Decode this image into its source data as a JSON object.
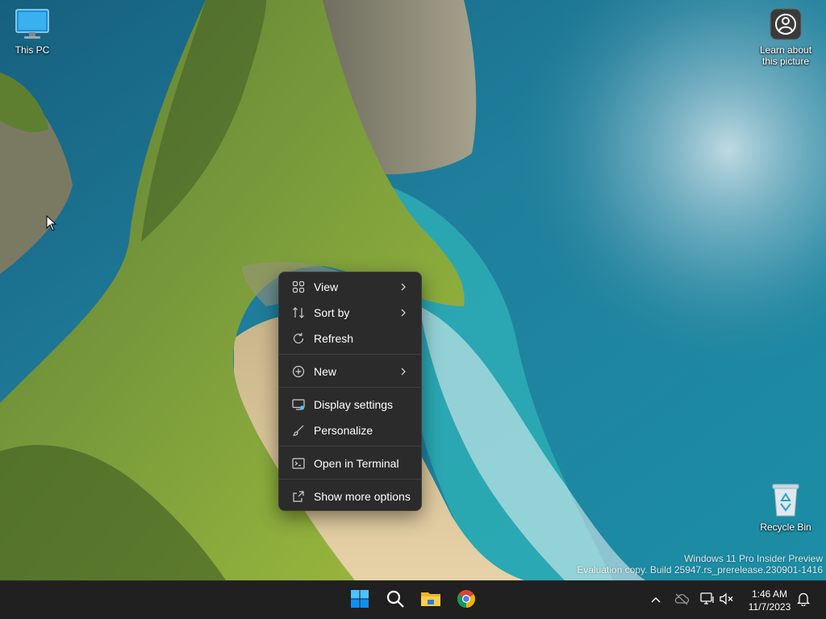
{
  "desktop": {
    "icons": [
      {
        "label": "This PC"
      },
      {
        "label": "Learn about this picture"
      },
      {
        "label": "Recycle Bin"
      }
    ],
    "watermark": {
      "line1": "Windows 11 Pro Insider Preview",
      "line2": "Evaluation copy. Build 25947.rs_prerelease.230901-1416"
    }
  },
  "context_menu": {
    "items": [
      {
        "label": "View",
        "icon": "grid-view-icon",
        "submenu": true
      },
      {
        "label": "Sort by",
        "icon": "sort-icon",
        "submenu": true
      },
      {
        "label": "Refresh",
        "icon": "refresh-icon",
        "submenu": false
      },
      {
        "label": "New",
        "icon": "plus-circle-icon",
        "submenu": true
      },
      {
        "label": "Display settings",
        "icon": "display-settings-icon",
        "submenu": false
      },
      {
        "label": "Personalize",
        "icon": "brush-icon",
        "submenu": false
      },
      {
        "label": "Open in Terminal",
        "icon": "terminal-icon",
        "submenu": false
      },
      {
        "label": "Show more options",
        "icon": "share-expand-icon",
        "submenu": false
      }
    ]
  },
  "taskbar": {
    "apps": [
      {
        "name": "start",
        "icon": "windows-logo-icon"
      },
      {
        "name": "search",
        "icon": "search-icon"
      },
      {
        "name": "file-explorer",
        "icon": "folder-icon"
      },
      {
        "name": "chrome",
        "icon": "chrome-icon"
      }
    ],
    "tray": [
      "chevron-up-icon",
      "cloud-offline-icon",
      "network-icon",
      "volume-muted-icon",
      "bell-icon"
    ],
    "clock": {
      "time": "1:46 AM",
      "date": "11/7/2023"
    }
  },
  "colors": {
    "menu_bg": "#2b2b2b",
    "taskbar_bg": "#202020",
    "accent": "#0078d4"
  }
}
